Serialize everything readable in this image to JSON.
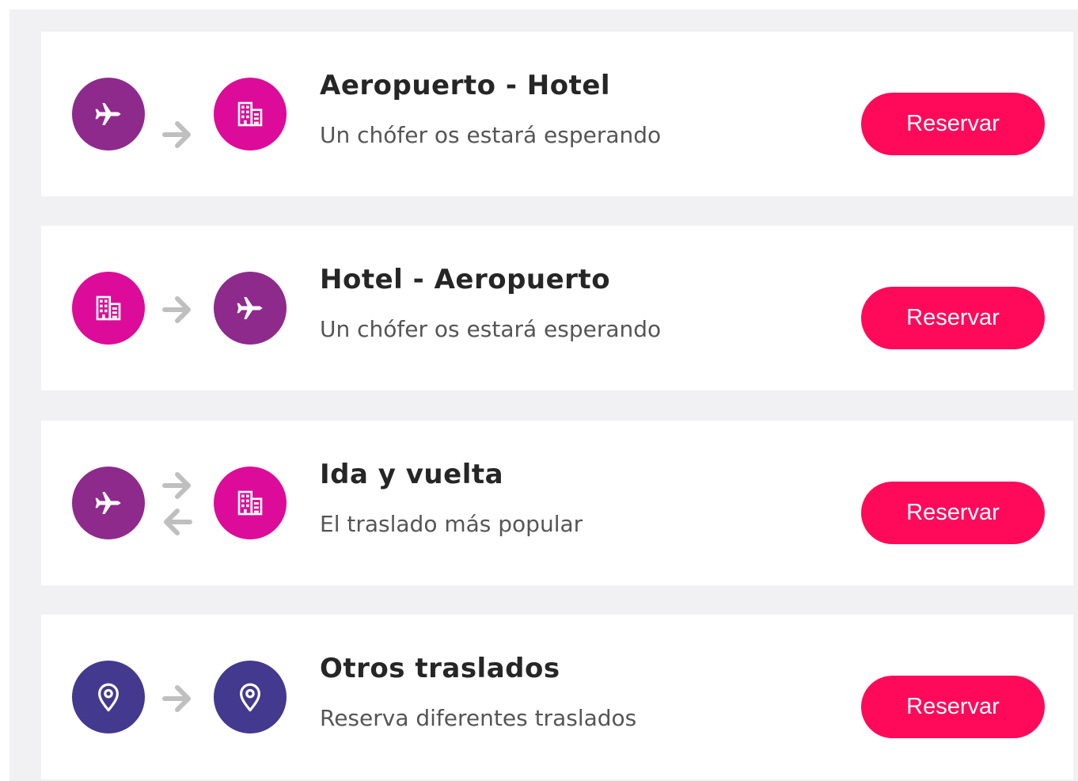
{
  "colors": {
    "plane": "#8e2a8c",
    "hotel": "#dd0b99",
    "pin": "#43398f",
    "button": "#ff0a5a",
    "arrow": "#bfbfbf"
  },
  "transfers": [
    {
      "title": "Aeropuerto - Hotel",
      "subtitle": "Un chófer os estará esperando",
      "from_icon": "plane-icon",
      "to_icon": "hotel-icon",
      "direction": "one-way",
      "button": "Reservar"
    },
    {
      "title": "Hotel - Aeropuerto",
      "subtitle": "Un chófer os estará esperando",
      "from_icon": "hotel-icon",
      "to_icon": "plane-icon",
      "direction": "one-way",
      "button": "Reservar"
    },
    {
      "title": "Ida y vuelta",
      "subtitle": "El traslado más popular",
      "from_icon": "plane-icon",
      "to_icon": "hotel-icon",
      "direction": "round-trip",
      "button": "Reservar"
    },
    {
      "title": "Otros traslados",
      "subtitle": "Reserva diferentes traslados",
      "from_icon": "location-pin-icon",
      "to_icon": "location-pin-icon",
      "direction": "one-way",
      "button": "Reservar"
    }
  ]
}
